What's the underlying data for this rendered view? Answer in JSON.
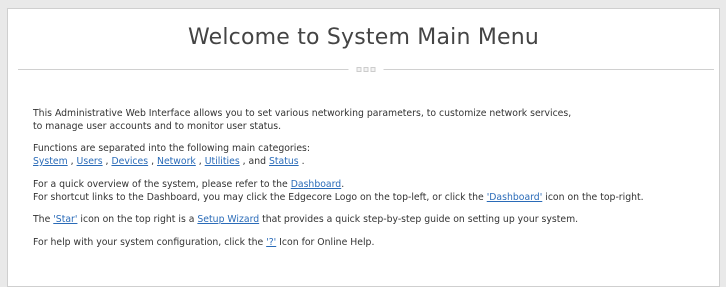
{
  "title": "Welcome to System Main Menu",
  "intro": {
    "line1": "This Administrative Web Interface allows you to set various networking parameters, to customize network services,",
    "line2": "to manage user accounts and to monitor user status."
  },
  "categories": {
    "text": "Functions are separated into the following main categories:",
    "system": "System",
    "sep1": " , ",
    "users": "Users",
    "sep2": " , ",
    "devices": "Devices",
    "sep3": " , ",
    "network": "Network",
    "sep4": " , ",
    "utilities": "Utilities",
    "sep5": " , and ",
    "status": "Status",
    "end": " ."
  },
  "dashboard": {
    "line1_pre": "For a quick overview of the system, please refer to the ",
    "line1_link": "Dashboard",
    "line1_post": ".",
    "line2_pre": "For shortcut links to the Dashboard, you may click the Edgecore Logo on the top-left, or click the ",
    "line2_link": "'Dashboard'",
    "line2_post": " icon on the top-right."
  },
  "star": {
    "pre": "The ",
    "link1": "'Star'",
    "mid": " icon on the top right is a ",
    "link2": "Setup Wizard",
    "post": " that provides a quick step-by-step guide on setting up your system."
  },
  "help": {
    "pre": "For help with your system configuration, click the ",
    "link": "'?'",
    "post": " Icon for Online Help."
  },
  "colors": {
    "link": "#2a6bb8",
    "text": "#333333",
    "title": "#444444"
  }
}
